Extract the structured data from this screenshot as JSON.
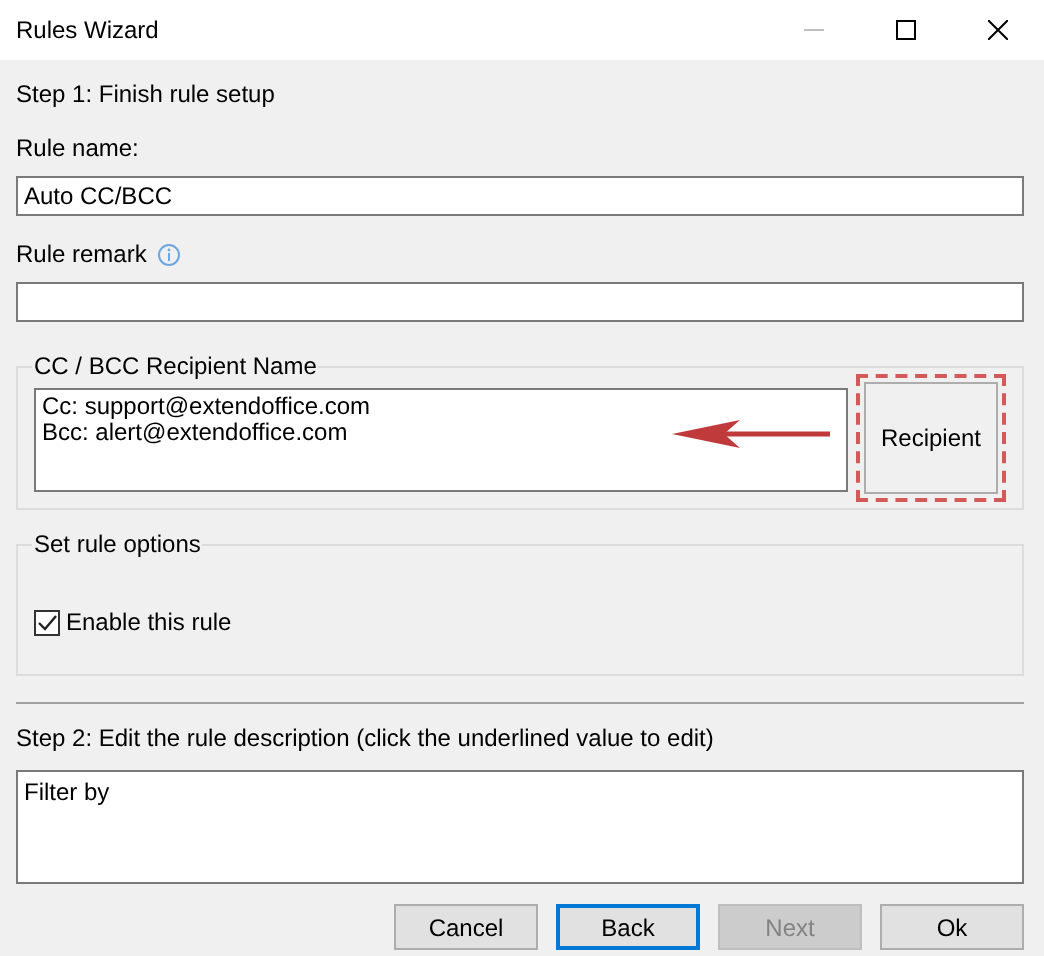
{
  "window": {
    "title": "Rules Wizard"
  },
  "step1": {
    "heading": "Step 1: Finish rule setup"
  },
  "rule_name": {
    "label": "Rule name:",
    "value": "Auto CC/BCC"
  },
  "rule_remark": {
    "label": "Rule remark"
  },
  "recipient_group": {
    "legend": "CC / BCC Recipient Name",
    "lines": [
      "Cc: support@extendoffice.com",
      "Bcc: alert@extendoffice.com"
    ],
    "button": "Recipient"
  },
  "options_group": {
    "legend": "Set rule options",
    "checkbox": {
      "label": "Enable this rule",
      "checked": true
    }
  },
  "step2": {
    "heading": "Step 2: Edit the rule description (click the underlined value to edit)",
    "description": "Filter by"
  },
  "buttons": [
    {
      "label": "Cancel",
      "focused": false,
      "disabled": false
    },
    {
      "label": "Back",
      "focused": true,
      "disabled": false
    },
    {
      "label": "Next",
      "focused": false,
      "disabled": true
    },
    {
      "label": "Ok",
      "focused": false,
      "disabled": false
    }
  ]
}
